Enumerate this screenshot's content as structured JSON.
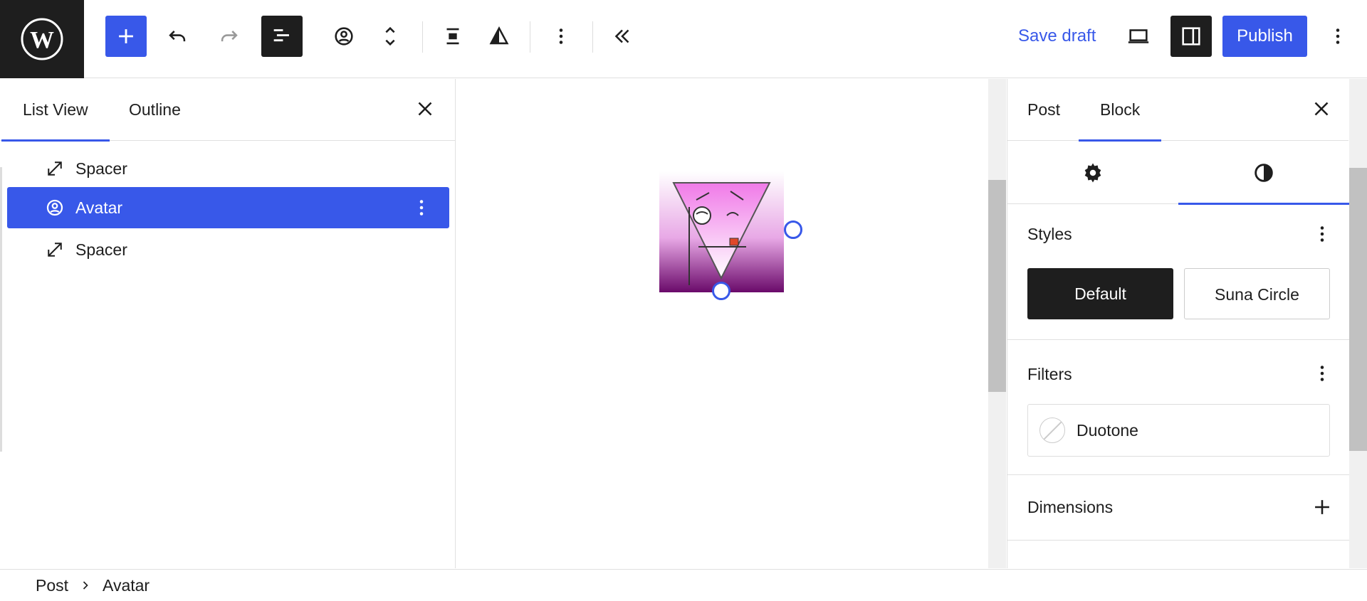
{
  "toolbar": {
    "save_draft": "Save draft",
    "publish": "Publish",
    "icons": [
      "wordpress-logo-icon",
      "add-block-icon",
      "undo-icon",
      "redo-icon",
      "document-overview-icon",
      "avatar-block-icon",
      "move-up-down-icon",
      "align-icon",
      "duotone-icon",
      "more-options-icon",
      "collapse-icon",
      "preview-icon",
      "settings-toggle-icon",
      "options-icon"
    ]
  },
  "left_panel": {
    "tabs": [
      {
        "label": "List View",
        "active": true
      },
      {
        "label": "Outline",
        "active": false
      }
    ],
    "items": [
      {
        "label": "Spacer",
        "icon": "spacer-icon",
        "selected": false
      },
      {
        "label": "Avatar",
        "icon": "avatar-icon",
        "selected": true
      },
      {
        "label": "Spacer",
        "icon": "spacer-icon",
        "selected": false
      }
    ]
  },
  "right_panel": {
    "tabs": [
      {
        "label": "Post",
        "active": false
      },
      {
        "label": "Block",
        "active": true
      }
    ],
    "subtabs": [
      {
        "icon": "settings-gear-icon",
        "active": false
      },
      {
        "icon": "styles-half-circle-icon",
        "active": true
      }
    ],
    "styles": {
      "title": "Styles",
      "options": [
        {
          "label": "Default",
          "active": true
        },
        {
          "label": "Suna Circle",
          "active": false
        }
      ]
    },
    "filters": {
      "title": "Filters",
      "duotone_label": "Duotone"
    },
    "dimensions": {
      "title": "Dimensions"
    }
  },
  "footer": {
    "breadcrumb": [
      "Post",
      "Avatar"
    ]
  },
  "colors": {
    "accent": "#3858e9",
    "dark": "#1e1e1e"
  }
}
